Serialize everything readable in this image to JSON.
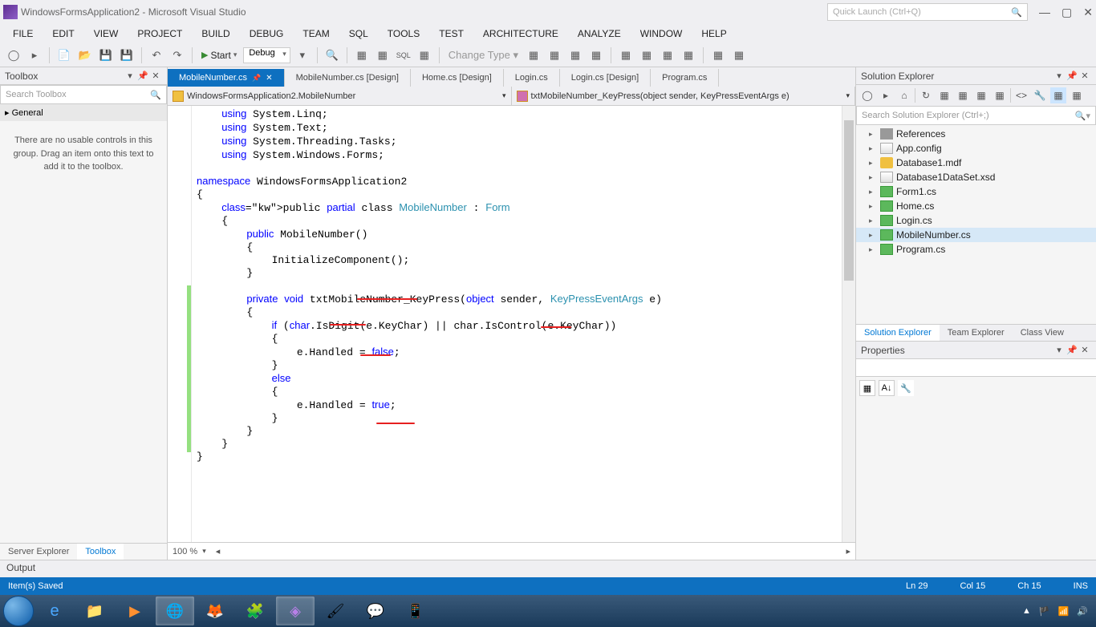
{
  "titlebar": {
    "title": "WindowsFormsApplication2 - Microsoft Visual Studio",
    "quick_launch_placeholder": "Quick Launch (Ctrl+Q)"
  },
  "menu": [
    "FILE",
    "EDIT",
    "VIEW",
    "PROJECT",
    "BUILD",
    "DEBUG",
    "TEAM",
    "SQL",
    "TOOLS",
    "TEST",
    "ARCHITECTURE",
    "ANALYZE",
    "WINDOW",
    "HELP"
  ],
  "toolbar": {
    "start": "Start",
    "config": "Debug",
    "change_type": "Change Type ▾"
  },
  "toolbox": {
    "title": "Toolbox",
    "search_placeholder": "Search Toolbox",
    "general": "▸ General",
    "message": "There are no usable controls in this group. Drag an item onto this text to add it to the toolbox.",
    "tabs": [
      "Server Explorer",
      "Toolbox"
    ]
  },
  "doc_tabs": [
    {
      "label": "MobileNumber.cs",
      "active": true,
      "pin": true
    },
    {
      "label": "MobileNumber.cs [Design]",
      "active": false
    },
    {
      "label": "Home.cs [Design]",
      "active": false
    },
    {
      "label": "Login.cs",
      "active": false
    },
    {
      "label": "Login.cs [Design]",
      "active": false
    },
    {
      "label": "Program.cs",
      "active": false
    }
  ],
  "nav": {
    "left": "WindowsFormsApplication2.MobileNumber",
    "right": "txtMobileNumber_KeyPress(object sender, KeyPressEventArgs e)"
  },
  "code": {
    "lines": [
      {
        "t": "    using System.Linq;",
        "kw": [
          "using"
        ]
      },
      {
        "t": "    using System.Text;",
        "kw": [
          "using"
        ]
      },
      {
        "t": "    using System.Threading.Tasks;",
        "kw": [
          "using"
        ]
      },
      {
        "t": "    using System.Windows.Forms;",
        "kw": [
          "using"
        ]
      },
      {
        "t": ""
      },
      {
        "t": "namespace WindowsFormsApplication2",
        "kw": [
          "namespace"
        ]
      },
      {
        "t": "{"
      },
      {
        "t": "    public partial class MobileNumber : Form",
        "kw": [
          "public",
          "partial",
          "class"
        ],
        "typ": [
          "MobileNumber",
          "Form"
        ]
      },
      {
        "t": "    {"
      },
      {
        "t": "        public MobileNumber()",
        "kw": [
          "public"
        ]
      },
      {
        "t": "        {"
      },
      {
        "t": "            InitializeComponent();"
      },
      {
        "t": "        }"
      },
      {
        "t": ""
      },
      {
        "t": "        private void txtMobileNumber_KeyPress(object sender, KeyPressEventArgs e)",
        "kw": [
          "private",
          "void",
          "object"
        ],
        "typ": [
          "KeyPressEventArgs"
        ]
      },
      {
        "t": "        {"
      },
      {
        "t": "            if (char.IsDigit(e.KeyChar) || char.IsControl(e.KeyChar))",
        "kw": [
          "if",
          "char",
          "char"
        ]
      },
      {
        "t": "            {"
      },
      {
        "t": "                e.Handled = false;",
        "kw": [
          "false"
        ]
      },
      {
        "t": "            }"
      },
      {
        "t": "            else",
        "kw": [
          "else"
        ]
      },
      {
        "t": "            {"
      },
      {
        "t": "                e.Handled = true;",
        "kw": [
          "true"
        ]
      },
      {
        "t": "            }"
      },
      {
        "t": "        }"
      },
      {
        "t": "    }"
      },
      {
        "t": "}"
      }
    ],
    "zoom": "100 %"
  },
  "solution_explorer": {
    "title": "Solution Explorer",
    "search_placeholder": "Search Solution Explorer (Ctrl+;)",
    "items": [
      {
        "label": "References",
        "icon": "wrench"
      },
      {
        "label": "App.config",
        "icon": "file"
      },
      {
        "label": "Database1.mdf",
        "icon": "db"
      },
      {
        "label": "Database1DataSet.xsd",
        "icon": "file"
      },
      {
        "label": "Form1.cs",
        "icon": "cs"
      },
      {
        "label": "Home.cs",
        "icon": "cs"
      },
      {
        "label": "Login.cs",
        "icon": "cs"
      },
      {
        "label": "MobileNumber.cs",
        "icon": "cs",
        "selected": true
      },
      {
        "label": "Program.cs",
        "icon": "cs"
      }
    ],
    "tabs": [
      "Solution Explorer",
      "Team Explorer",
      "Class View"
    ]
  },
  "properties": {
    "title": "Properties"
  },
  "output": {
    "title": "Output"
  },
  "status": {
    "left": "Item(s) Saved",
    "ln": "Ln 29",
    "col": "Col 15",
    "ch": "Ch 15",
    "ins": "INS"
  }
}
